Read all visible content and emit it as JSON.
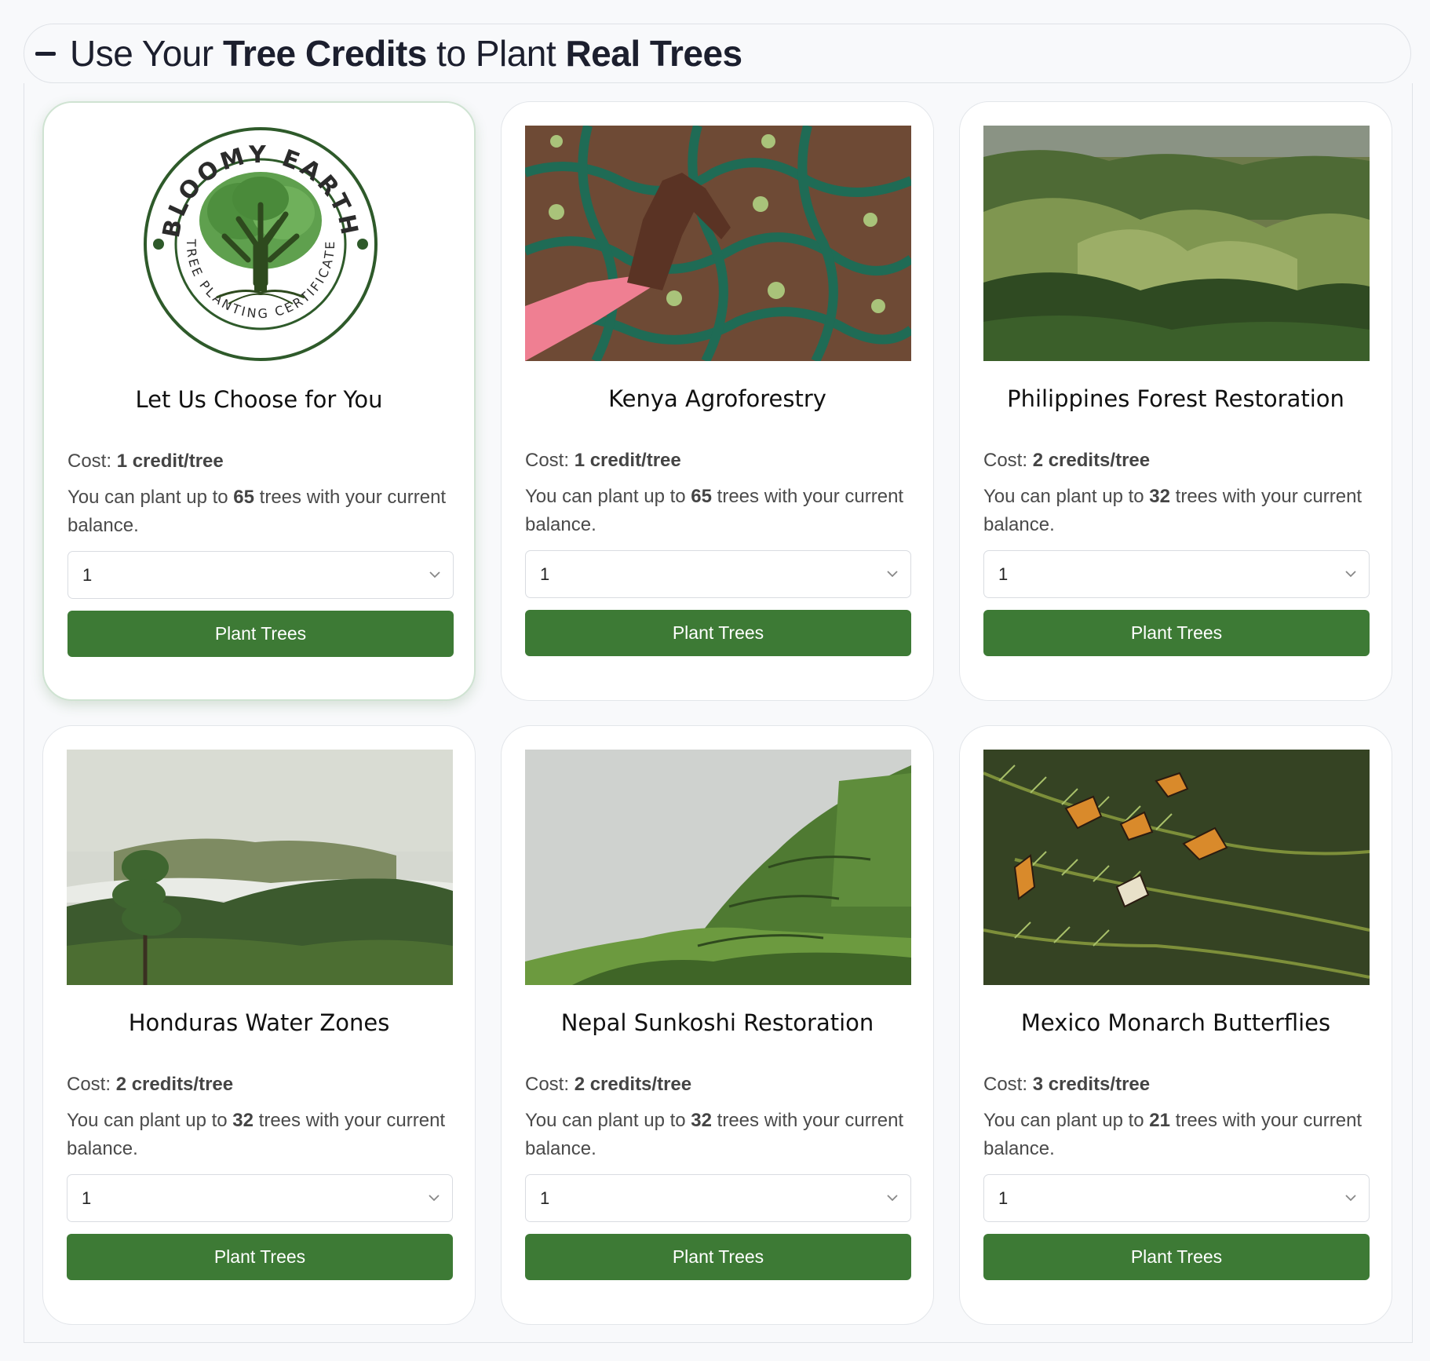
{
  "header": {
    "collapse_icon": "minus-icon",
    "title_prefix_1": "Use Your ",
    "title_bold_1": "Tree Credits",
    "title_mid": " to Plant ",
    "title_bold_2": "Real Trees"
  },
  "colors": {
    "button": "#3d7a35",
    "selected_border": "#cfe3d2"
  },
  "logo": {
    "top_text": "BLOOMY EARTH",
    "bottom_text": "TREE PLANTING CERTIFICATE"
  },
  "common": {
    "cost_label": "Cost: ",
    "capacity_prefix": "You can plant up to ",
    "capacity_suffix": " trees with your current balance.",
    "button_label": "Plant Trees",
    "select_value": "1"
  },
  "projects": [
    {
      "name": "Let Us Choose for You",
      "cost": "1 credit/tree",
      "max_trees": "65",
      "selected": true
    },
    {
      "name": "Kenya Agroforestry",
      "cost": "1 credit/tree",
      "max_trees": "65",
      "selected": false
    },
    {
      "name": "Philippines Forest Restoration",
      "cost": "2 credits/tree",
      "max_trees": "32",
      "selected": false
    },
    {
      "name": "Honduras Water Zones",
      "cost": "2 credits/tree",
      "max_trees": "32",
      "selected": false
    },
    {
      "name": "Nepal Sunkoshi Restoration",
      "cost": "2 credits/tree",
      "max_trees": "32",
      "selected": false
    },
    {
      "name": "Mexico Monarch Butterflies",
      "cost": "3 credits/tree",
      "max_trees": "21",
      "selected": false
    }
  ]
}
